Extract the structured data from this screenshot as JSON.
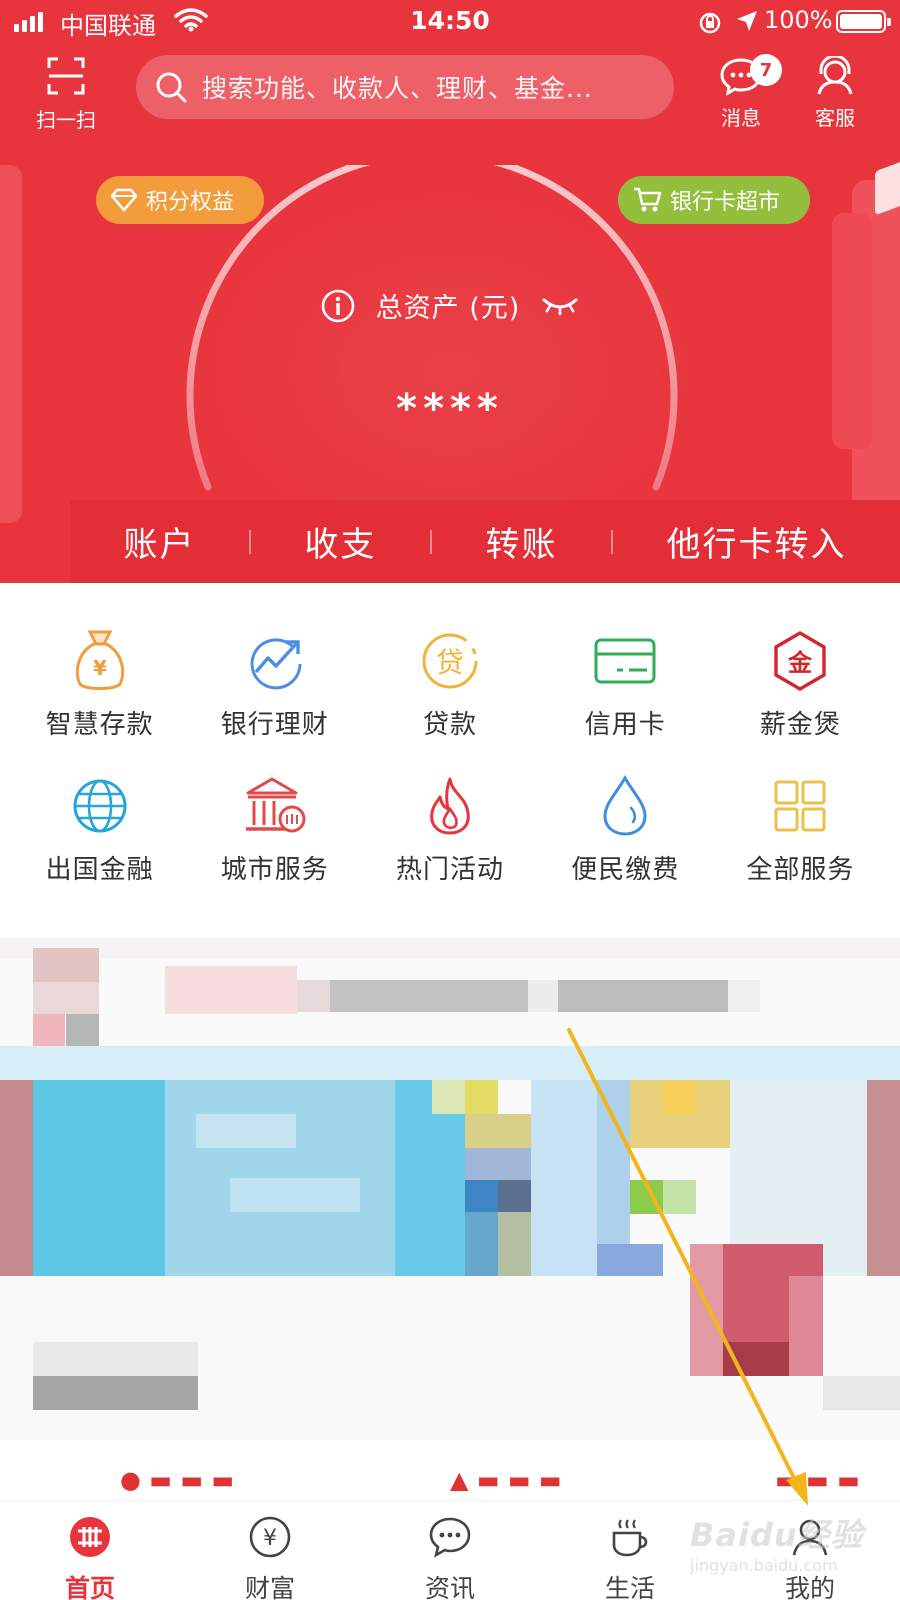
{
  "status_bar": {
    "carrier": "中国联通",
    "time": "14:50",
    "battery": "100%"
  },
  "header": {
    "scan_label": "扫一扫",
    "search_placeholder": "搜索功能、收款人、理财、基金...",
    "messages_label": "消息",
    "messages_badge": "7",
    "service_label": "客服"
  },
  "hero": {
    "points_pill": "积分权益",
    "market_pill": "银行卡超市",
    "assets_label": "总资产 (元)",
    "assets_value": "****",
    "quick_actions": [
      "账户",
      "收支",
      "转账",
      "他行卡转入"
    ]
  },
  "services": [
    {
      "label": "智慧存款",
      "icon": "money-bag-icon"
    },
    {
      "label": "银行理财",
      "icon": "trend-chart-icon"
    },
    {
      "label": "贷款",
      "icon": "loan-icon"
    },
    {
      "label": "信用卡",
      "icon": "credit-card-icon"
    },
    {
      "label": "薪金煲",
      "icon": "gold-hexagon-icon"
    },
    {
      "label": "出国金融",
      "icon": "globe-icon"
    },
    {
      "label": "城市服务",
      "icon": "bank-building-icon"
    },
    {
      "label": "热门活动",
      "icon": "flame-icon"
    },
    {
      "label": "便民缴费",
      "icon": "water-drop-icon"
    },
    {
      "label": "全部服务",
      "icon": "grid-icon"
    }
  ],
  "tabs": [
    {
      "label": "首页",
      "icon": "citic-logo-icon",
      "active": true
    },
    {
      "label": "财富",
      "icon": "yen-coin-icon",
      "active": false
    },
    {
      "label": "资讯",
      "icon": "chat-bubble-icon",
      "active": false
    },
    {
      "label": "生活",
      "icon": "coffee-cup-icon",
      "active": false
    },
    {
      "label": "我的",
      "icon": "user-icon",
      "active": false
    }
  ],
  "watermark": {
    "logo_text": "Baidu经验",
    "url": "jingyan.baidu.com"
  },
  "colors": {
    "brand_red": "#e8343d",
    "points_orange": "#f39c3b",
    "market_green": "#94bf3c",
    "annotation_arrow": "#f2b61b"
  }
}
